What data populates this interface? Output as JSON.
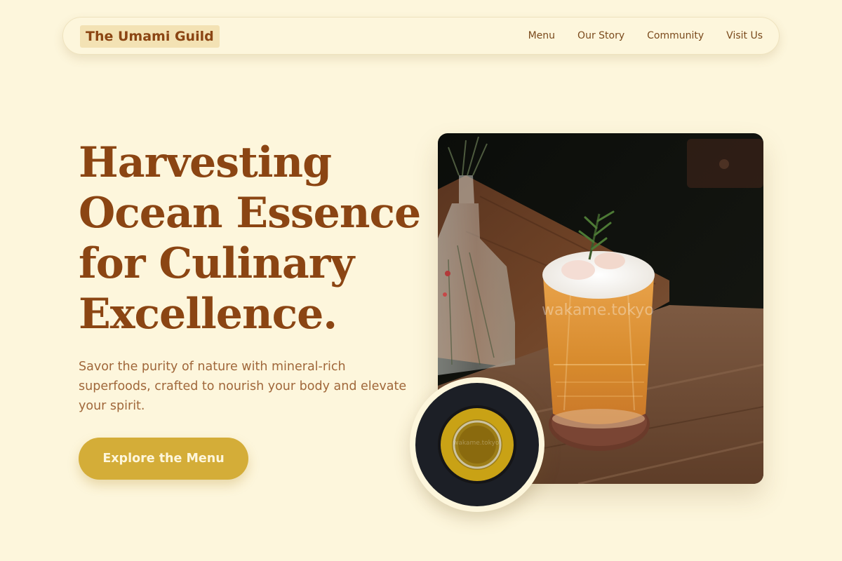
{
  "brand": {
    "name": "The Umami Guild"
  },
  "nav": {
    "links": [
      {
        "label": "Menu"
      },
      {
        "label": "Our Story"
      },
      {
        "label": "Community"
      },
      {
        "label": "Visit Us"
      }
    ]
  },
  "hero": {
    "title_lines": [
      "Harvesting",
      "Ocean Essence",
      "for Culinary",
      "Excellence."
    ],
    "subtitle": "Savor the purity of nature with mineral-rich superfoods, crafted to nourish your body and elevate your spirit.",
    "cta_label": "Explore the Menu"
  },
  "images": {
    "main_watermark": "wakame.tokyo",
    "inset_watermark": "wakame.tokyo"
  },
  "colors": {
    "background": "#fdf6dc",
    "brand_brown": "#8b4513",
    "accent_gold": "#d4ad38",
    "text_muted": "#a0673a"
  }
}
